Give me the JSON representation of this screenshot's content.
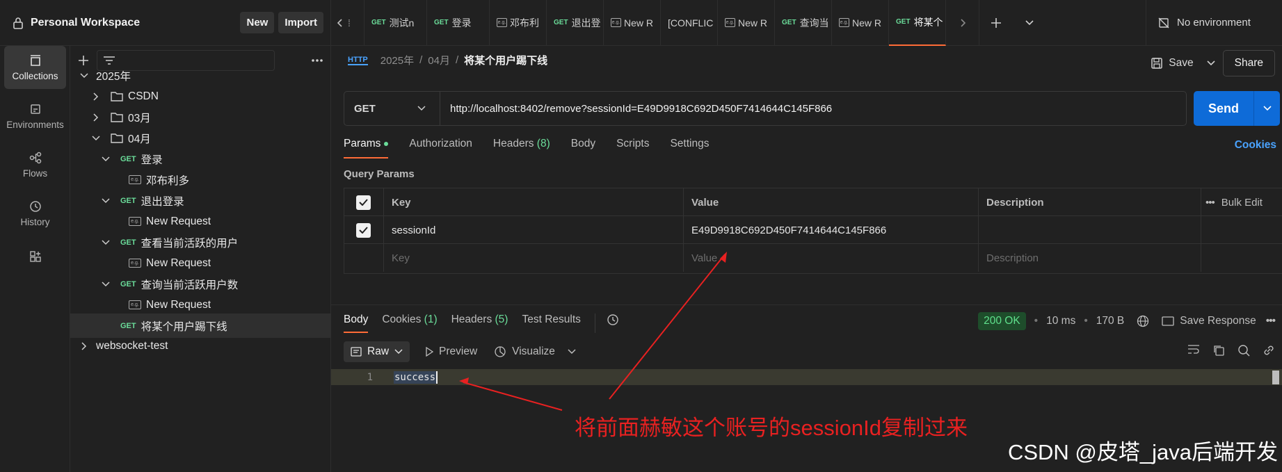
{
  "workspace": {
    "title": "Personal Workspace",
    "new_label": "New",
    "import_label": "Import"
  },
  "sidebar": {
    "items": [
      {
        "label": "Collections",
        "icon": "collections-icon"
      },
      {
        "label": "Environments",
        "icon": "environments-icon"
      },
      {
        "label": "Flows",
        "icon": "flows-icon"
      },
      {
        "label": "History",
        "icon": "history-icon"
      },
      {
        "label": "",
        "icon": "configure-sidebar-icon"
      }
    ]
  },
  "tree": [
    {
      "label": "2025年",
      "type": "collection",
      "level": 0,
      "expanded": true
    },
    {
      "label": "CSDN",
      "type": "folder",
      "level": 1,
      "expanded": false
    },
    {
      "label": "03月",
      "type": "folder",
      "level": 1,
      "expanded": false
    },
    {
      "label": "04月",
      "type": "folder",
      "level": 1,
      "expanded": true
    },
    {
      "label": "登录",
      "type": "request",
      "method": "GET",
      "level": 2,
      "expanded": true
    },
    {
      "label": "邓布利多",
      "type": "example",
      "level": 3
    },
    {
      "label": "退出登录",
      "type": "request",
      "method": "GET",
      "level": 2,
      "expanded": true
    },
    {
      "label": "New Request",
      "type": "example",
      "level": 3
    },
    {
      "label": "查看当前活跃的用户",
      "type": "request",
      "method": "GET",
      "level": 2,
      "expanded": true
    },
    {
      "label": "New Request",
      "type": "example",
      "level": 3
    },
    {
      "label": "查询当前活跃用户数",
      "type": "request",
      "method": "GET",
      "level": 2,
      "expanded": true
    },
    {
      "label": "New Request",
      "type": "example",
      "level": 3
    },
    {
      "label": "将某个用户踢下线",
      "type": "request",
      "method": "GET",
      "level": 2,
      "selected": true
    },
    {
      "label": "websocket-test",
      "type": "collection",
      "level": 0,
      "expanded": false
    }
  ],
  "tabs": [
    {
      "method": "GET",
      "label": "测试n"
    },
    {
      "method": "GET",
      "label": "登录"
    },
    {
      "method": "",
      "label": "邓布利",
      "example": true
    },
    {
      "method": "GET",
      "label": "退出登"
    },
    {
      "method": "",
      "label": "New R",
      "example": true
    },
    {
      "method": "",
      "label": "[CONFLIC",
      "dot": true
    },
    {
      "method": "",
      "label": "New R",
      "example": true
    },
    {
      "method": "GET",
      "label": "查询当"
    },
    {
      "method": "",
      "label": "New R",
      "example": true
    },
    {
      "method": "GET",
      "label": "将某个",
      "dot": true,
      "active": true
    }
  ],
  "environment": "No environment",
  "breadcrumb": {
    "parts": [
      "2025年",
      "04月"
    ],
    "current": "将某个用户踢下线"
  },
  "toolbar": {
    "save_label": "Save",
    "share_label": "Share"
  },
  "request": {
    "method": "GET",
    "url": "http://localhost:8402/remove?sessionId=E49D9918C692D450F7414644C145F866",
    "send_label": "Send"
  },
  "req_tabs": {
    "params": "Params",
    "authorization": "Authorization",
    "headers": "Headers",
    "headers_count": "(8)",
    "body": "Body",
    "scripts": "Scripts",
    "settings": "Settings",
    "cookies": "Cookies"
  },
  "query_params": {
    "title": "Query Params",
    "columns": {
      "key": "Key",
      "value": "Value",
      "description": "Description",
      "bulk": "Bulk Edit"
    },
    "rows": [
      {
        "checked": true,
        "key": "sessionId",
        "value": "E49D9918C692D450F7414644C145F866",
        "description": ""
      }
    ],
    "placeholders": {
      "key": "Key",
      "value": "Value",
      "description": "Description"
    }
  },
  "response": {
    "tabs": {
      "body": "Body",
      "cookies": "Cookies",
      "cookies_count": "(1)",
      "headers": "Headers",
      "headers_count": "(5)",
      "tests": "Test Results"
    },
    "status": "200 OK",
    "time": "10 ms",
    "size": "170 B",
    "save_response": "Save Response",
    "format": "Raw",
    "preview": "Preview",
    "visualize": "Visualize",
    "line_number": "1",
    "body_text": "success"
  },
  "annotation": {
    "text": "将前面赫敏这个账号的sessionId复制过来",
    "color": "#e82121"
  },
  "watermark": "CSDN @皮塔_java后端开发",
  "colors": {
    "accent": "#ff6c37",
    "send": "#0e6bd8",
    "get": "#6bdd9a",
    "link": "#4aa3ff",
    "ok": "#5fe08c"
  }
}
